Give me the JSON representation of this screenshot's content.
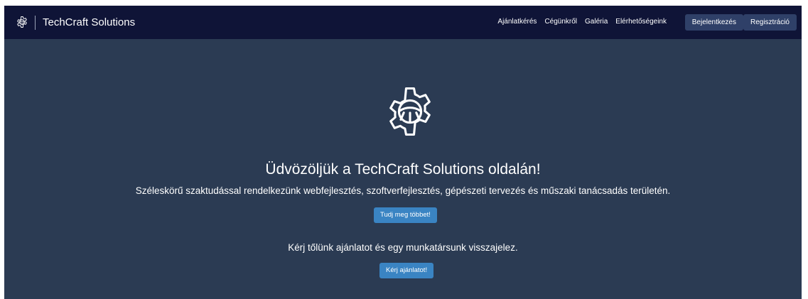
{
  "navbar": {
    "brand_icon": "gear-icon",
    "brand_name": "TechCraft Solutions",
    "links": [
      "Ajánlatkérés",
      "Cégünkről",
      "Galéria",
      "Elérhetőségeink"
    ],
    "login_label": "Bejelentkezés",
    "register_label": "Regisztráció"
  },
  "hero": {
    "icon": "gear-icon",
    "title": "Üdvözöljük a TechCraft Solutions oldalán!",
    "subtitle": "Széleskörű szaktudással rendelkezünk webfejlesztés, szoftverfejlesztés, gépészeti tervezés és műszaki tanácsadás területén.",
    "more_button": "Tudj meg többet!",
    "offer_text": "Kérj tőlünk ajánlatot és egy munkatársunk visszajelez.",
    "offer_button": "Kérj ajánlatot!"
  },
  "colors": {
    "navbar_bg": "#0f1437",
    "page_bg": "#2b3b53",
    "nav_button_bg": "#2f4068",
    "cta_button_bg": "#3a84c3"
  }
}
